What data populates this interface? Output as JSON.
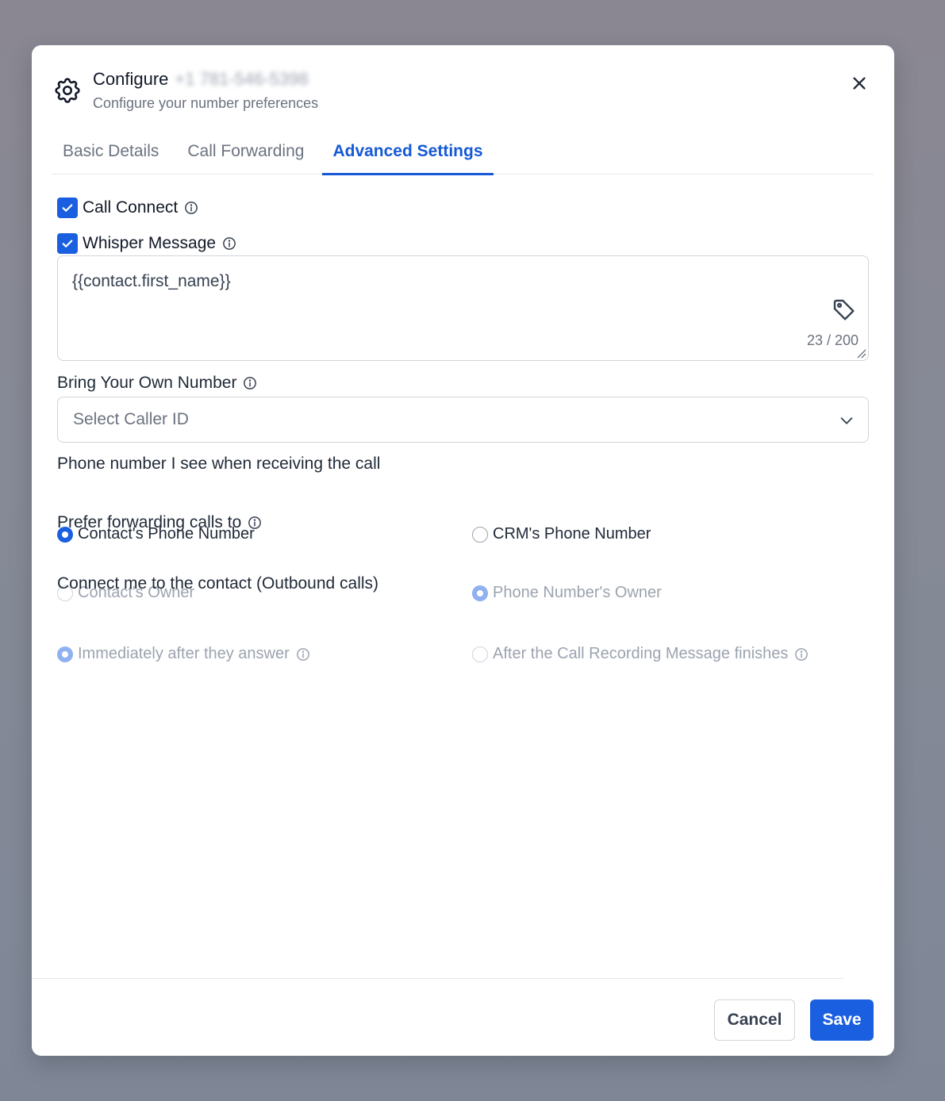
{
  "header": {
    "title": "Configure",
    "number": "+1 781-546-5398",
    "subtitle": "Configure your number preferences"
  },
  "tabs": [
    {
      "label": "Basic Details",
      "active": false
    },
    {
      "label": "Call Forwarding",
      "active": false
    },
    {
      "label": "Advanced Settings",
      "active": true
    }
  ],
  "call_connect": {
    "label": "Call Connect",
    "checked": true
  },
  "whisper": {
    "label": "Whisper Message",
    "checked": true,
    "value": "{{contact.first_name}}",
    "counter": "23 / 200"
  },
  "byon": {
    "label": "Bring Your Own Number",
    "placeholder": "Select Caller ID"
  },
  "phone_seen": {
    "label": "Phone number I see when receiving the call",
    "options": [
      "Contact's Phone Number",
      "CRM's Phone Number"
    ],
    "selected": 0
  },
  "prefer_forwarding": {
    "label": "Prefer forwarding calls to",
    "options": [
      "Contact's Owner",
      "Phone Number's Owner"
    ],
    "selected": 1
  },
  "connect_me": {
    "label": "Connect me to the contact (Outbound calls)",
    "options": [
      "Immediately after they answer",
      "After the Call Recording Message finishes"
    ],
    "selected": 0
  },
  "footer": {
    "cancel": "Cancel",
    "save": "Save"
  },
  "colors": {
    "accent": "#1a5fe0",
    "tab_active": "#1559d6"
  }
}
